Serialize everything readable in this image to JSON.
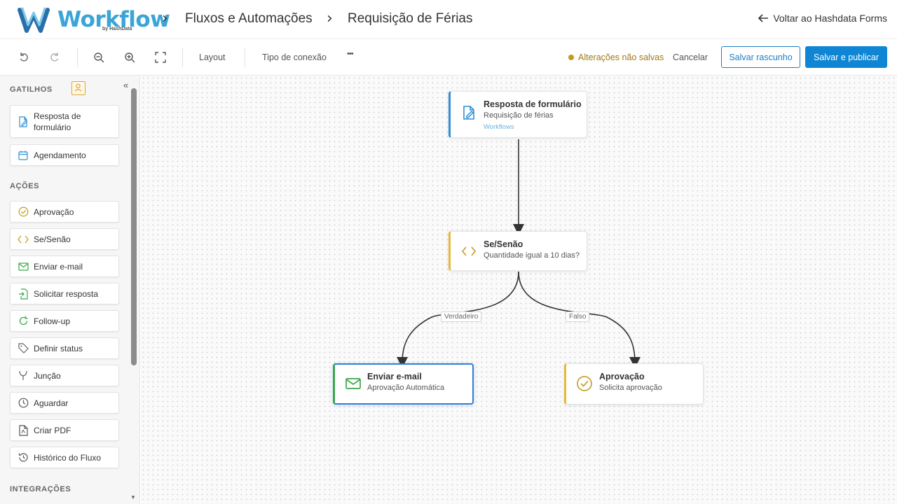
{
  "header": {
    "logo_text": "Workflow",
    "logo_sub": "by HashData",
    "breadcrumb": [
      "Fluxos e Automações",
      "Requisição de Férias"
    ],
    "back_link": "Voltar ao Hashdata Forms"
  },
  "toolbar": {
    "layout": "Layout",
    "connection_type": "Tipo de conexão",
    "more": "•••",
    "unsaved": "Alterações não salvas",
    "cancel": "Cancelar",
    "save_draft": "Salvar rascunho",
    "save_publish": "Salvar e publicar"
  },
  "sidebar": {
    "triggers_title": "GATILHOS",
    "triggers": [
      {
        "label": "Resposta de formulário",
        "icon": "form-edit-icon"
      },
      {
        "label": "Agendamento",
        "icon": "calendar-icon"
      }
    ],
    "actions_title": "AÇÕES",
    "actions": [
      {
        "label": "Aprovação",
        "icon": "check-circle-icon"
      },
      {
        "label": "Se/Senão",
        "icon": "code-brackets-icon"
      },
      {
        "label": "Enviar e-mail",
        "icon": "mail-icon"
      },
      {
        "label": "Solicitar resposta",
        "icon": "request-doc-icon"
      },
      {
        "label": "Follow-up",
        "icon": "refresh-icon"
      },
      {
        "label": "Definir status",
        "icon": "tag-icon"
      },
      {
        "label": "Junção",
        "icon": "merge-icon"
      },
      {
        "label": "Aguardar",
        "icon": "clock-icon"
      },
      {
        "label": "Criar PDF",
        "icon": "pdf-icon"
      },
      {
        "label": "Histórico do Fluxo",
        "icon": "history-icon"
      }
    ],
    "integrations_title": "INTEGRAÇÕES"
  },
  "canvas": {
    "nodes": {
      "trigger": {
        "title": "Resposta de formulário",
        "subtitle": "Requisição de férias",
        "tag": "Workflows",
        "accent": "#2f8fd6"
      },
      "condition": {
        "title": "Se/Senão",
        "subtitle": "Quantidade igual a 10 dias?",
        "accent": "#e8b83a"
      },
      "email": {
        "title": "Enviar e-mail",
        "subtitle": "Aprovação Automática",
        "accent": "#3aa64a",
        "selected_border": "#2f7fd6"
      },
      "approval": {
        "title": "Aprovação",
        "subtitle": "Solicita aprovação",
        "accent": "#e8b83a"
      }
    },
    "edge_labels": {
      "true": "Verdadeiro",
      "false": "Falso"
    }
  }
}
